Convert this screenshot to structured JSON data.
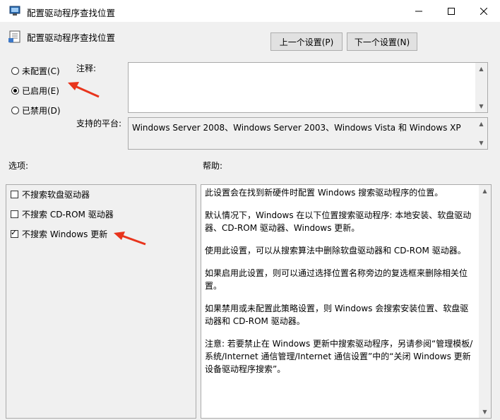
{
  "window": {
    "title": "配置驱动程序查找位置"
  },
  "header": {
    "policy_name": "配置驱动程序查找位置",
    "prev_button": "上一个设置(P)",
    "next_button": "下一个设置(N)"
  },
  "state": {
    "options": [
      {
        "label": "未配置(C)",
        "selected": false
      },
      {
        "label": "已启用(E)",
        "selected": true
      },
      {
        "label": "已禁用(D)",
        "selected": false
      }
    ]
  },
  "comment": {
    "label": "注释:",
    "value": ""
  },
  "platform": {
    "label": "支持的平台:",
    "value": "Windows Server 2008、Windows Server 2003、Windows Vista 和 Windows XP"
  },
  "options_panel": {
    "label": "选项:",
    "checkboxes": [
      {
        "label": "不搜索软盘驱动器",
        "checked": false
      },
      {
        "label": "不搜索 CD-ROM 驱动器",
        "checked": false
      },
      {
        "label": "不搜索 Windows 更新",
        "checked": true
      }
    ]
  },
  "help_panel": {
    "label": "帮助:",
    "paragraphs": [
      "此设置会在找到新硬件时配置 Windows 搜索驱动程序的位置。",
      "默认情况下，Windows 在以下位置搜索驱动程序: 本地安装、软盘驱动器、CD-ROM 驱动器、Windows 更新。",
      "使用此设置，可以从搜索算法中删除软盘驱动器和 CD-ROM 驱动器。",
      "如果启用此设置，则可以通过选择位置名称旁边的复选框来删除相关位置。",
      "如果禁用或未配置此策略设置，则 Windows 会搜索安装位置、软盘驱动器和 CD-ROM 驱动器。",
      "注意: 若要禁止在 Windows 更新中搜索驱动程序，另请参阅“管理模板/系统/Internet 通信管理/Internet 通信设置”中的“关闭 Windows 更新设备驱动程序搜索”。"
    ]
  },
  "colors": {
    "annotation_arrow": "#e8341c",
    "window_bg": "#f0f0f0"
  }
}
